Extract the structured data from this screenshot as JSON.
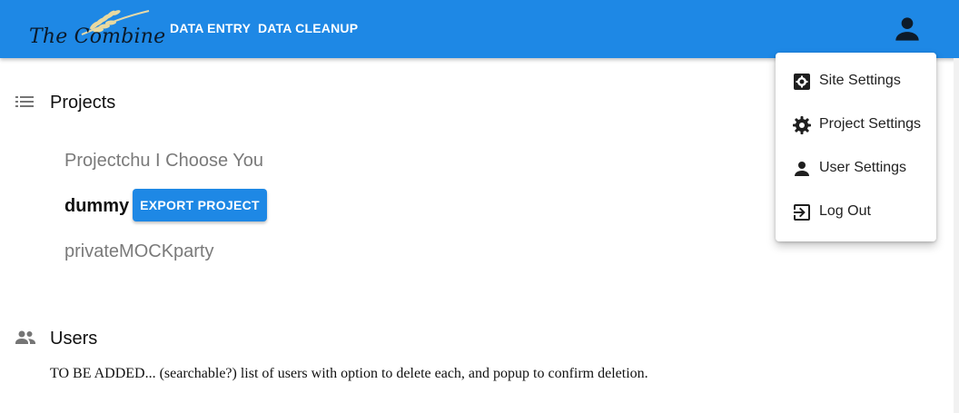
{
  "appbar": {
    "logo_text": "The Combine",
    "nav": [
      {
        "label": "DATA ENTRY"
      },
      {
        "label": "DATA CLEANUP"
      }
    ],
    "accent_color": "#1e88e5"
  },
  "projects_section": {
    "title": "Projects",
    "icon": "list-icon",
    "items": [
      {
        "name": "Projectchu I Choose You",
        "active": false
      },
      {
        "name": "dummy",
        "active": true
      },
      {
        "name": "privateMOCKparty",
        "active": false
      }
    ],
    "export_label": "EXPORT PROJECT"
  },
  "users_section": {
    "title": "Users",
    "icon": "group-icon",
    "note": "TO BE ADDED... (searchable?) list of users with option to delete each, and popup to confirm deletion."
  },
  "user_menu": {
    "items": [
      {
        "label": "Site Settings",
        "icon": "site-settings-icon"
      },
      {
        "label": "Project Settings",
        "icon": "gear-icon"
      },
      {
        "label": "User Settings",
        "icon": "person-icon"
      },
      {
        "label": "Log Out",
        "icon": "logout-icon"
      }
    ]
  }
}
